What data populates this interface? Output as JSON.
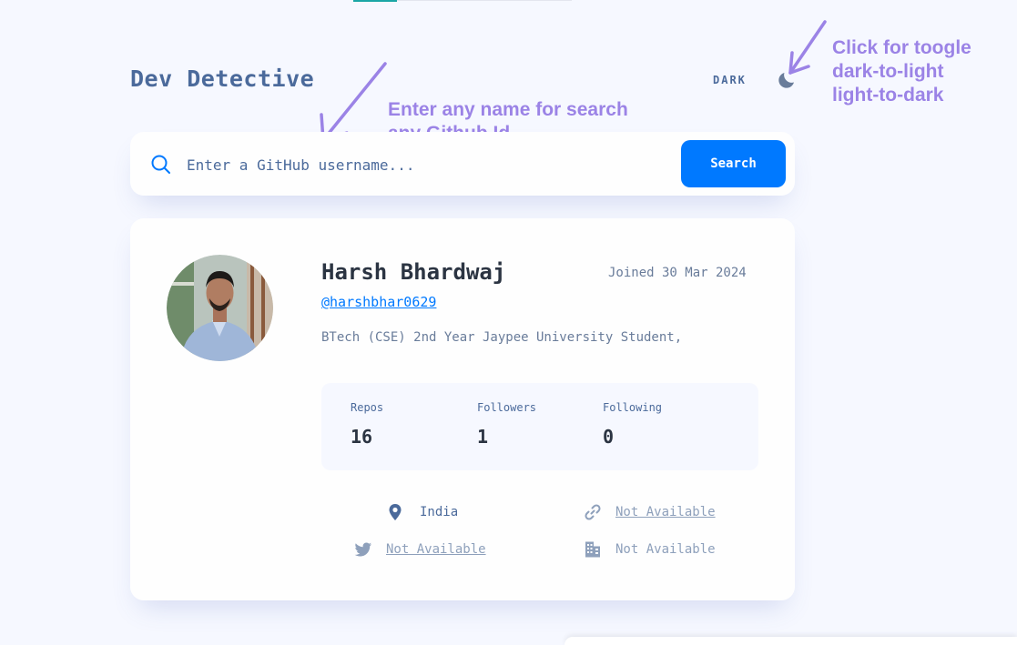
{
  "header": {
    "title": "Dev Detective",
    "theme_label": "DARK"
  },
  "annotations": {
    "search_hint": [
      "Enter any name for search",
      "any Github Id"
    ],
    "toggle_hint": [
      "Click for toogle",
      "dark-to-light",
      "light-to-dark"
    ]
  },
  "search": {
    "placeholder": "Enter a GitHub username...",
    "value": "",
    "button_label": "Search"
  },
  "profile": {
    "name": "Harsh Bhardwaj",
    "joined": "Joined 30 Mar 2024",
    "handle": "@harshbhar0629",
    "bio": "BTech (CSE) 2nd Year Jaypee University Student,",
    "stats": [
      {
        "label": "Repos",
        "value": "16"
      },
      {
        "label": "Followers",
        "value": "1"
      },
      {
        "label": "Following",
        "value": "0"
      }
    ],
    "info": {
      "location": "India",
      "website": "Not Available",
      "twitter": "Not Available",
      "company": "Not Available"
    }
  },
  "icons": {
    "theme": "moon-icon",
    "search": "search-icon",
    "location": "location-pin-icon",
    "website": "link-icon",
    "twitter": "twitter-icon",
    "company": "building-icon"
  },
  "colors": {
    "accent": "#0079ff",
    "annotation": "#9b83e6",
    "background": "#f6f8ff",
    "title": "#4b6a9b"
  }
}
